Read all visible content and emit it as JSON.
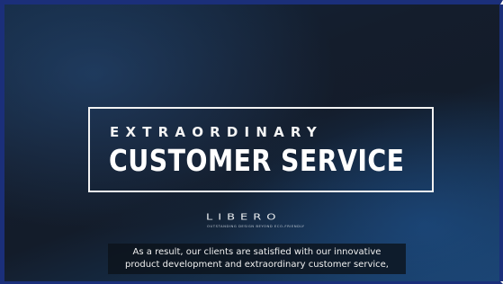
{
  "video": {
    "title_line1": "EXTRAORDINARY",
    "title_line2": "CUSTOMER SERVICE",
    "logo": {
      "brand": "LIBERO",
      "tagline": "OUTSTANDING DESIGN BEYOND ECO-FRIENDLY"
    },
    "caption": {
      "line1": "As a result, our clients are satisfied with our innovative",
      "line2": "product development and extraordinary customer service,"
    }
  },
  "colors": {
    "frame_border": "#1b2f7a",
    "title_text": "#ffffff",
    "background_dark": "#141d2c",
    "background_blue": "#1a416b"
  }
}
